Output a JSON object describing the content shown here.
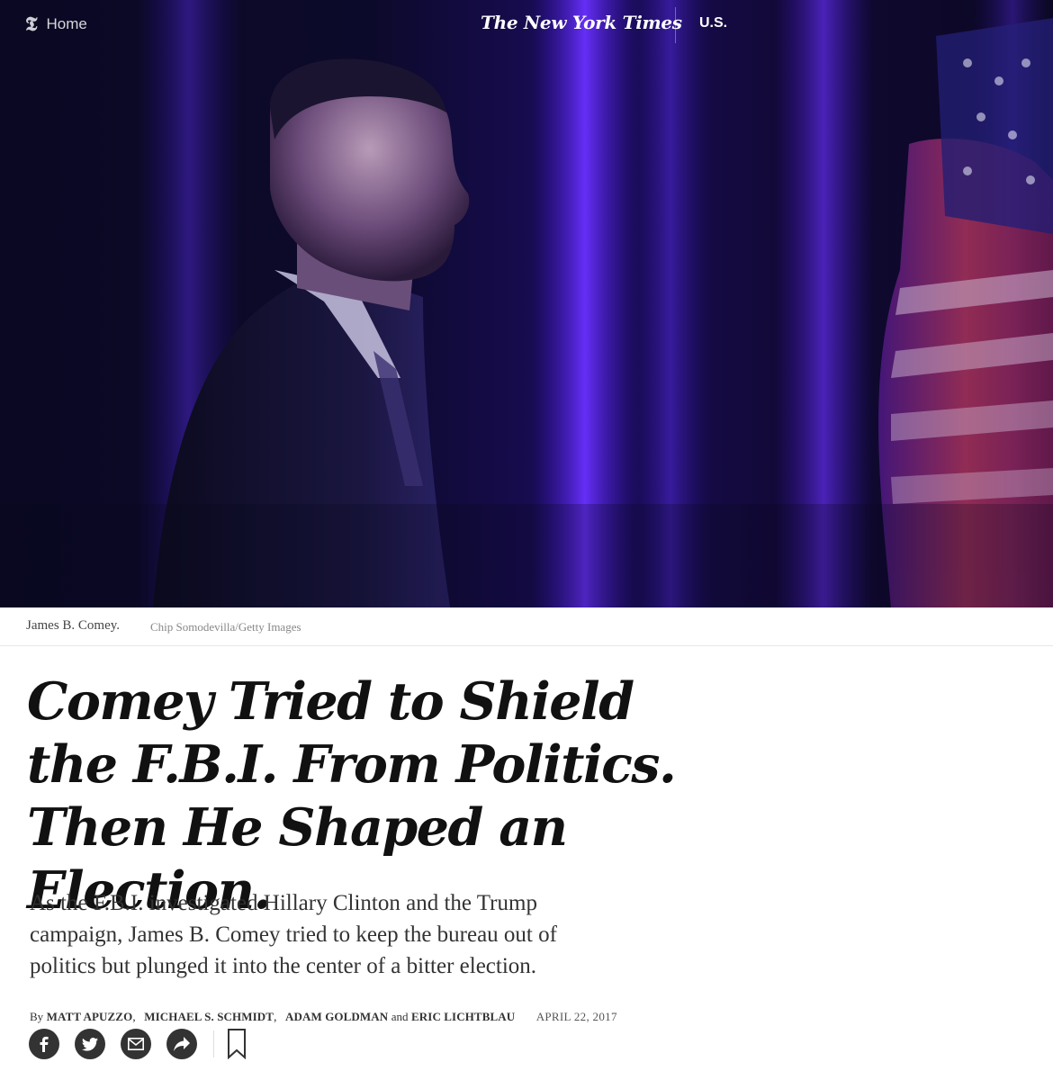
{
  "header": {
    "home_label": "Home",
    "masthead": "The New York Times",
    "section": "U.S."
  },
  "hero": {
    "caption": "James B. Comey.",
    "credit": "Chip Somodevilla/Getty Images"
  },
  "article": {
    "headline": "Comey Tried to Shield the F.B.I. From Politics. Then He Shaped an Election.",
    "summary": "As the F.B.I. investigated Hillary Clinton and the Trump campaign, James B. Comey tried to keep the bureau out of politics but plunged it into the center of a bitter election.",
    "byline_prefix": "By",
    "authors": [
      "MATT APUZZO",
      "MICHAEL S. SCHMIDT",
      "ADAM GOLDMAN",
      "ERIC LICHTBLAU"
    ],
    "conjunction": "and",
    "date": "APRIL 22, 2017"
  },
  "share": {
    "buttons": [
      "facebook-icon",
      "twitter-icon",
      "email-icon",
      "share-arrow-icon"
    ],
    "save": "bookmark-icon"
  },
  "colors": {
    "hero_bg": "#07061a",
    "stage_purple": "#4a1fd6",
    "text_dark": "#111111",
    "share_bg": "#333333"
  }
}
